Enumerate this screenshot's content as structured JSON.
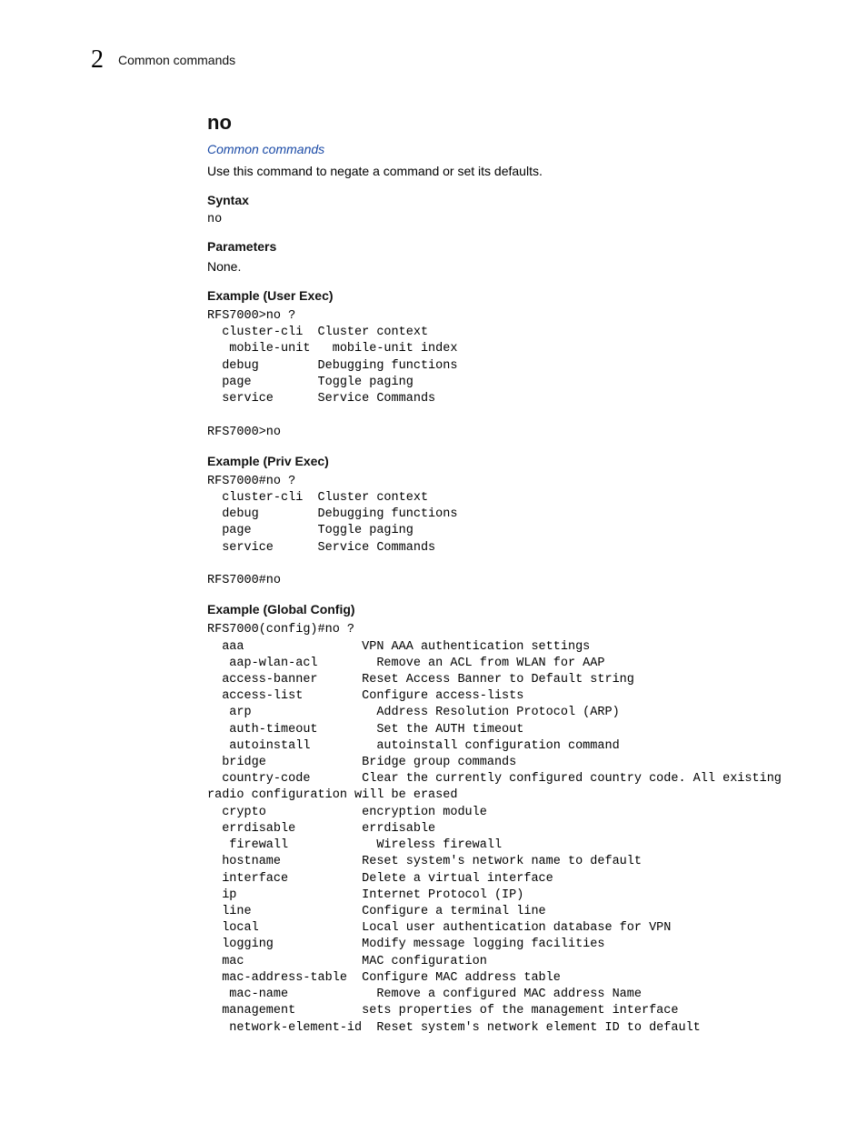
{
  "header": {
    "chapter_number": "2",
    "chapter_title": "Common commands"
  },
  "cmd": {
    "title": "no",
    "breadcrumb_link": "Common commands",
    "description": "Use this command to negate a command or set its defaults.",
    "syntax_label": "Syntax",
    "syntax": "no",
    "parameters_label": "Parameters",
    "parameters": "None.",
    "example_user_exec_label": "Example (User Exec)",
    "example_user_exec": "RFS7000>no ?\n  cluster-cli  Cluster context\n   mobile-unit   mobile-unit index\n  debug        Debugging functions\n  page         Toggle paging\n  service      Service Commands\n\nRFS7000>no",
    "example_priv_exec_label": "Example (Priv Exec)",
    "example_priv_exec": "RFS7000#no ?\n  cluster-cli  Cluster context\n  debug        Debugging functions\n  page         Toggle paging\n  service      Service Commands\n\nRFS7000#no",
    "example_global_config_label": "Example (Global Config)",
    "example_global_config": "RFS7000(config)#no ?\n  aaa                VPN AAA authentication settings\n   aap-wlan-acl        Remove an ACL from WLAN for AAP\n  access-banner      Reset Access Banner to Default string\n  access-list        Configure access-lists\n   arp                 Address Resolution Protocol (ARP)\n   auth-timeout        Set the AUTH timeout\n   autoinstall         autoinstall configuration command\n  bridge             Bridge group commands\n  country-code       Clear the currently configured country code. All existing \nradio configuration will be erased\n  crypto             encryption module\n  errdisable         errdisable\n   firewall            Wireless firewall\n  hostname           Reset system's network name to default\n  interface          Delete a virtual interface\n  ip                 Internet Protocol (IP)\n  line               Configure a terminal line\n  local              Local user authentication database for VPN\n  logging            Modify message logging facilities\n  mac                MAC configuration\n  mac-address-table  Configure MAC address table\n   mac-name            Remove a configured MAC address Name\n  management         sets properties of the management interface\n   network-element-id  Reset system's network element ID to default"
  }
}
